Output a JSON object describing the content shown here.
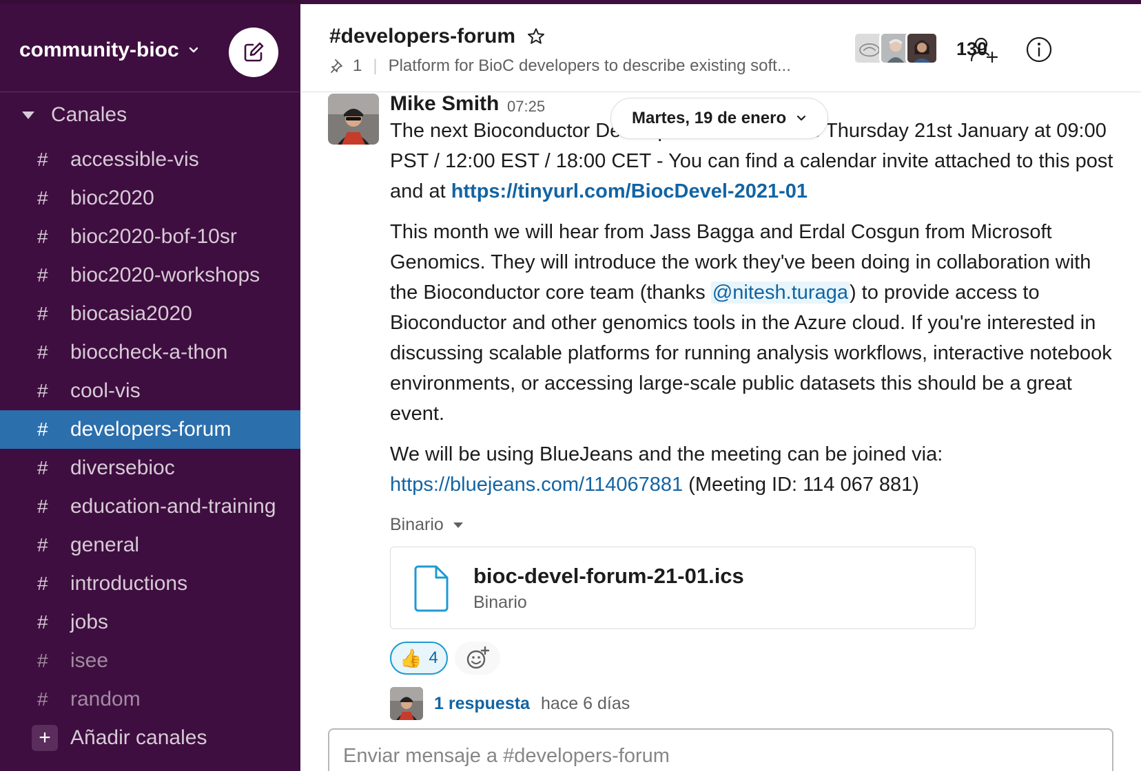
{
  "workspace": {
    "name": "community-bioc"
  },
  "sidebar": {
    "section_label": "Canales",
    "channels": [
      {
        "name": "accessible-vis"
      },
      {
        "name": "bioc2020"
      },
      {
        "name": "bioc2020-bof-10sr"
      },
      {
        "name": "bioc2020-workshops"
      },
      {
        "name": "biocasia2020"
      },
      {
        "name": "bioccheck-a-thon"
      },
      {
        "name": "cool-vis"
      },
      {
        "name": "developers-forum"
      },
      {
        "name": "diversebioc"
      },
      {
        "name": "education-and-training"
      },
      {
        "name": "general"
      },
      {
        "name": "introductions"
      },
      {
        "name": "jobs"
      },
      {
        "name": "isee"
      },
      {
        "name": "random"
      }
    ],
    "hash_symbol": "#",
    "active_channel": "developers-forum",
    "add_channels_label": "Añadir canales",
    "colors": {
      "background": "#3f0e40",
      "active": "#2b6fad"
    }
  },
  "header": {
    "channel_title": "#developers-forum",
    "pinned_count": "1",
    "topic": "Platform for BioC developers to describe existing soft...",
    "member_count": "130"
  },
  "date_divider": {
    "label": "Martes, 19 de enero"
  },
  "message": {
    "author": "Mike Smith",
    "time": "07:25",
    "p1_before": "The next Bioconductor Developers' Forum is this Thursday 21st January at 09:00 PST / 12:00 EST / 18:00 CET - You can find a calendar invite attached to this post and at ",
    "p1_link": "https://tinyurl.com/BiocDevel-2021-01",
    "p2_before": "This month we will hear from Jass Bagga and Erdal Cosgun from Microsoft Genomics. They will introduce the work they've been doing in collaboration with the Bioconductor core team (thanks ",
    "p2_mention": "@nitesh.turaga",
    "p2_after": ") to provide access to Bioconductor and other genomics tools in the Azure cloud. If you're interested in discussing scalable platforms for running analysis workflows, interactive notebook environments, or accessing large-scale public datasets this should be a great event.",
    "p3_before": "We will be using BlueJeans and the meeting can be joined via: ",
    "p3_link": "https://bluejeans.com/114067881",
    "p3_after": " (Meeting ID: 114 067 881)"
  },
  "attachment": {
    "section_label": "Binario",
    "file_name": "bioc-devel-forum-21-01.ics",
    "file_type": "Binario"
  },
  "reactions": [
    {
      "emoji": "👍",
      "count": "4"
    }
  ],
  "thread": {
    "replies_label": "1 respuesta",
    "last_reply": "hace 6 días"
  },
  "composer": {
    "placeholder": "Enviar mensaje a #developers-forum",
    "value": ""
  },
  "icons": {
    "compose": "compose-icon",
    "star": "star-icon",
    "pin": "pin-icon",
    "add_people": "add-person-icon",
    "info": "info-icon",
    "file": "file-icon",
    "add_reaction": "add-reaction-icon"
  }
}
